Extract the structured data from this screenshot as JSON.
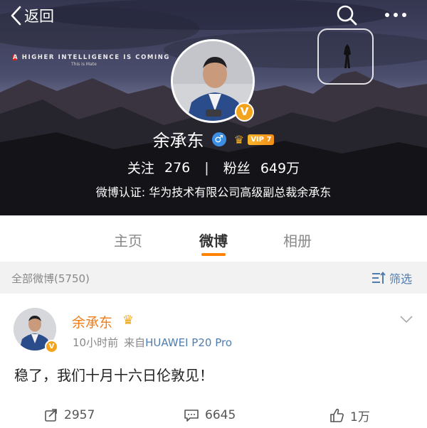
{
  "header": {
    "back_label": "返回",
    "icons": [
      "chevron-left-icon",
      "search-icon",
      "more-icon"
    ],
    "cover": {
      "slogan": "A HIGHER INTELLIGENCE IS COMING",
      "slogan_sub": "This is Mate"
    }
  },
  "profile": {
    "name": "余承东",
    "gender_symbol": "♂",
    "vip_label": "VIP 7",
    "verified_badge": "V",
    "following_label": "关注",
    "following_count": "276",
    "separator": "|",
    "followers_label": "粉丝",
    "followers_count": "649万",
    "verification": "微博认证: 华为技术有限公司高级副总裁余承东"
  },
  "tabs": [
    {
      "label": "主页",
      "active": false
    },
    {
      "label": "微博",
      "active": true
    },
    {
      "label": "相册",
      "active": false
    }
  ],
  "list_header": {
    "count_label": "全部微博(5750)",
    "filter_label": "筛选"
  },
  "post": {
    "author": "余承东",
    "time": "10小时前",
    "source_prefix": "来自",
    "device": "HUAWEI P20 Pro",
    "text": "稳了，我们十月十六日伦敦见！",
    "reposts": "2957",
    "comments": "6645",
    "likes": "1万"
  },
  "colors": {
    "accent_orange": "#ff8200",
    "author_orange": "#ef7d1a",
    "link_blue": "#507daf",
    "verified_gold": "#f4a31c"
  }
}
